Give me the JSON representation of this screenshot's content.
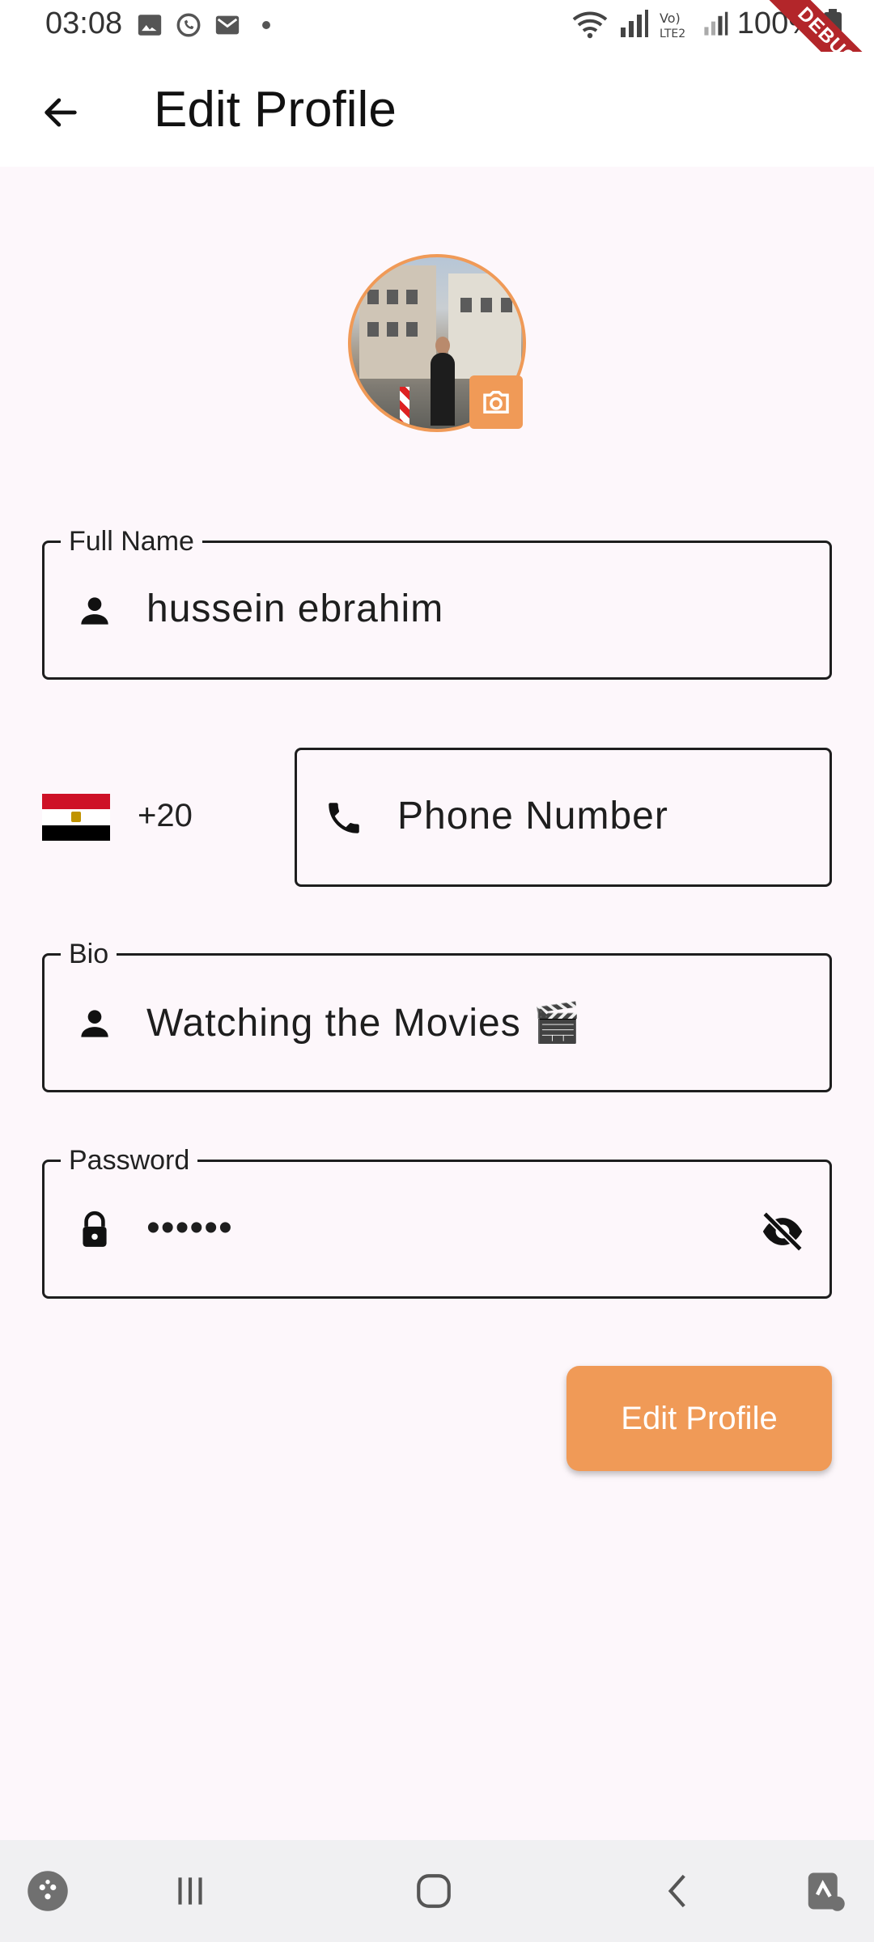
{
  "status_bar": {
    "time": "03:08",
    "battery": "100%",
    "notification_icons": [
      "gallery-icon",
      "whatsapp-icon",
      "mail-icon",
      "dot-icon"
    ],
    "system_icons": [
      "wifi-icon",
      "signal-icon",
      "volte-icon",
      "signal-icon"
    ]
  },
  "debug_banner": "DEBUG",
  "app_bar": {
    "title": "Edit Profile",
    "back_icon": "arrow-left-icon"
  },
  "avatar": {
    "camera_icon": "camera-icon",
    "border_color": "#f09a57"
  },
  "form": {
    "full_name": {
      "label": "Full Name",
      "value": "hussein ebrahim",
      "icon": "person-icon"
    },
    "phone": {
      "country_flag": "egypt-flag-icon",
      "dial_code": "+20",
      "placeholder": "Phone Number",
      "icon": "phone-icon"
    },
    "bio": {
      "label": "Bio",
      "value": "Watching the Movies 🎬",
      "icon": "person-icon"
    },
    "password": {
      "label": "Password",
      "value": "••••••",
      "icon": "lock-icon",
      "toggle_icon": "eye-off-icon"
    }
  },
  "submit_button": {
    "label": "Edit Profile",
    "color": "#f09a57"
  },
  "nav_bar": {
    "items": [
      "game-launcher-icon",
      "recents-icon",
      "home-icon",
      "back-icon",
      "assistant-icon"
    ]
  },
  "colors": {
    "accent": "#f09a57",
    "background": "#fdf7fb",
    "field_border": "#1e1e1e"
  }
}
